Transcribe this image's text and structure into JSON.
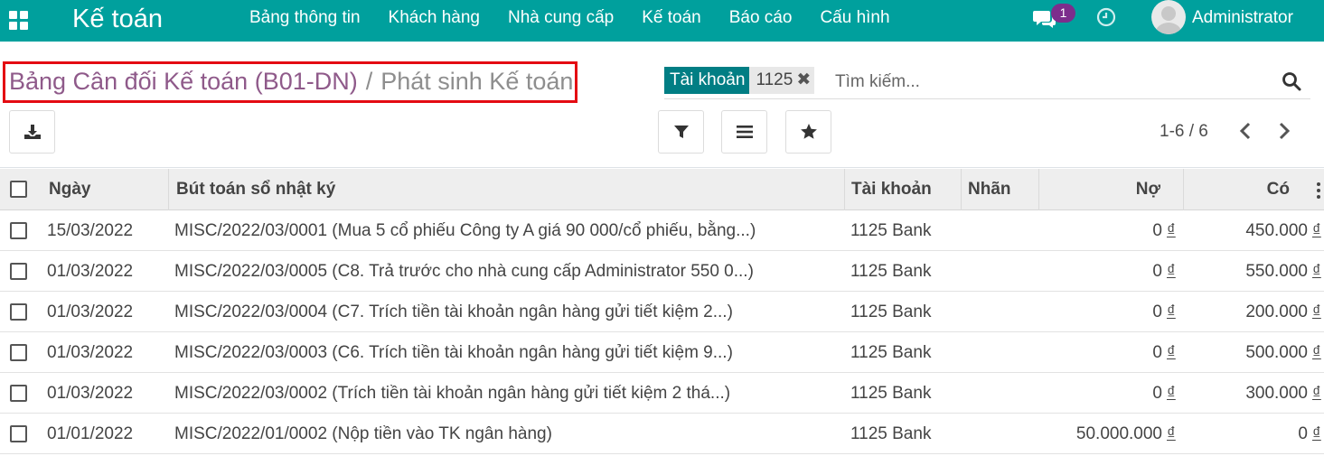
{
  "app": {
    "title": "Kế toán"
  },
  "menu": [
    {
      "label": "Bảng thông tin"
    },
    {
      "label": "Khách hàng"
    },
    {
      "label": "Nhà cung cấp"
    },
    {
      "label": "Kế toán"
    },
    {
      "label": "Báo cáo"
    },
    {
      "label": "Cấu hình"
    }
  ],
  "systray": {
    "message_count": "1",
    "user_name": "Administrator"
  },
  "breadcrumb": {
    "parent": "Bảng Cân đối Kế toán (B01-DN)",
    "separator": "/",
    "current": "Phát sinh Kế toán"
  },
  "search": {
    "facet_label": "Tài khoản",
    "facet_value": "1125",
    "facet_remove": "✖",
    "placeholder": "Tìm kiếm..."
  },
  "pager": {
    "text": "1-6 / 6"
  },
  "table": {
    "columns": [
      "Ngày",
      "Bút toán sổ nhật ký",
      "Tài khoản",
      "Nhãn",
      "Nợ",
      "Có"
    ],
    "currency_symbol": "₫",
    "rows": [
      {
        "date": "15/03/2022",
        "entry": "MISC/2022/03/0001 (Mua 5 cổ phiếu Công ty A giá 90 000/cổ phiếu, bằng...)",
        "account": "1125 Bank",
        "label": "",
        "debit": "0",
        "credit": "450.000"
      },
      {
        "date": "01/03/2022",
        "entry": "MISC/2022/03/0005 (C8. Trả trước cho nhà cung cấp Administrator 550 0...)",
        "account": "1125 Bank",
        "label": "",
        "debit": "0",
        "credit": "550.000"
      },
      {
        "date": "01/03/2022",
        "entry": "MISC/2022/03/0004 (C7. Trích tiền tài khoản ngân hàng gửi tiết kiệm 2...)",
        "account": "1125 Bank",
        "label": "",
        "debit": "0",
        "credit": "200.000"
      },
      {
        "date": "01/03/2022",
        "entry": "MISC/2022/03/0003 (C6. Trích tiền tài khoản ngân hàng gửi tiết kiệm 9...)",
        "account": "1125 Bank",
        "label": "",
        "debit": "0",
        "credit": "500.000"
      },
      {
        "date": "01/03/2022",
        "entry": "MISC/2022/03/0002 (Trích tiền tài khoản ngân hàng gửi tiết kiệm 2 thá...)",
        "account": "1125 Bank",
        "label": "",
        "debit": "0",
        "credit": "300.000"
      },
      {
        "date": "01/01/2022",
        "entry": "MISC/2022/01/0002 (Nộp tiền vào TK ngân hàng)",
        "account": "1125 Bank",
        "label": "",
        "debit": "50.000.000",
        "credit": "0"
      }
    ]
  },
  "colors": {
    "brand": "#00a09d",
    "facet": "#017e84",
    "breadcrumb_link": "#8f5a8a",
    "badge": "#7c2d8c",
    "highlight_box": "#e40b12"
  },
  "icons": [
    "apps-grid-icon",
    "chat-icon",
    "clock-icon",
    "avatar-icon",
    "search-icon",
    "download-icon",
    "filter-icon",
    "group-by-icon",
    "star-icon",
    "chevron-left-icon",
    "chevron-right-icon",
    "kebab-icon"
  ]
}
